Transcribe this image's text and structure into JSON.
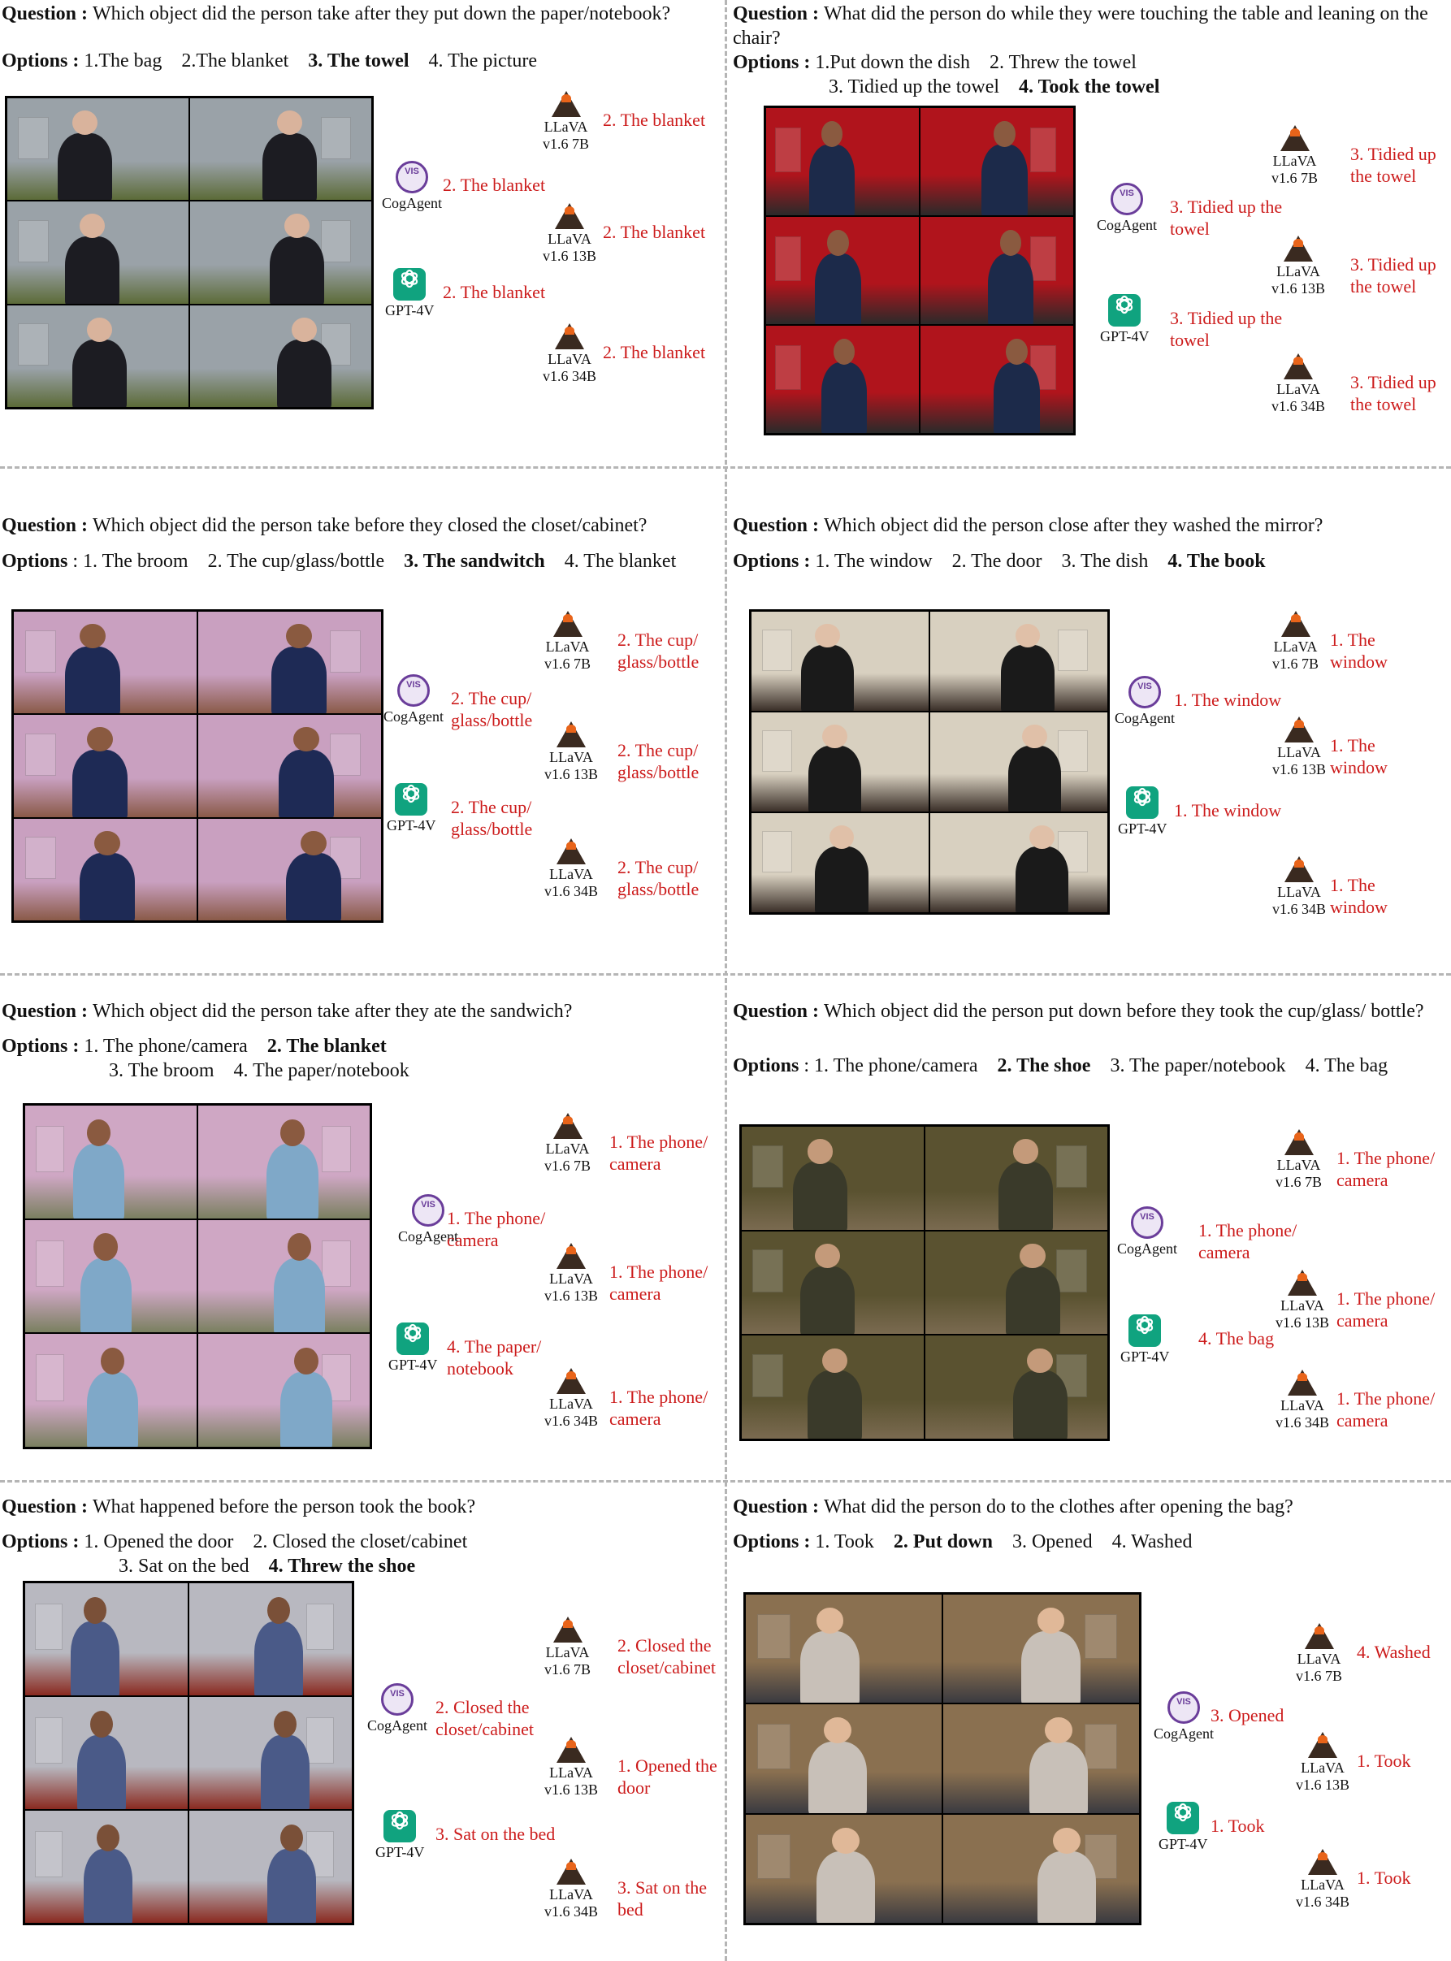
{
  "labels": {
    "question": "Question :",
    "options": "Options :",
    "options_alt": "Options"
  },
  "colors": {
    "answer": "#cc1b1b",
    "separator": "#b5b5b5",
    "gpt": "#10a37f",
    "cogagent": "#6a3d9a"
  },
  "icons": {
    "llava": "volcano-icon",
    "cogagent": "cogagent-logo-icon",
    "gpt4v": "openai-logo-icon"
  },
  "models": {
    "llava7": [
      "LLaVA",
      "v1.6 7B"
    ],
    "llava13": [
      "LLaVA",
      "v1.6 13B"
    ],
    "llava34": [
      "LLaVA",
      "v1.6 34B"
    ],
    "cog": "CogAgent",
    "gpt": "GPT-4V"
  },
  "panels": [
    {
      "question": "Which object did the person take after they put down the paper/notebook?",
      "options_line1": [
        {
          "t": "1.The bag",
          "b": false
        },
        {
          "t": "2.The blanket",
          "b": false
        },
        {
          "t": "3. The towel",
          "b": true
        },
        {
          "t": "4. The picture",
          "b": false
        }
      ],
      "options_line2": [],
      "answers": {
        "cog": "2. The blanket",
        "gpt": "2. The blanket",
        "llava7": "2. The blanket",
        "llava13": "2. The blanket",
        "llava34": "2. The blanket"
      }
    },
    {
      "question": "What did the person do while they were touching the table and leaning on the chair?",
      "options_line1": [
        {
          "t": "1.Put down the dish",
          "b": false
        },
        {
          "t": "2. Threw the towel",
          "b": false
        }
      ],
      "options_line2": [
        {
          "t": "3. Tidied up the towel",
          "b": false
        },
        {
          "t": "4. Took the towel",
          "b": true
        }
      ],
      "answers": {
        "cog": "3. Tidied up the towel",
        "gpt": "3. Tidied up the towel",
        "llava7": "3. Tidied up the towel",
        "llava13": "3. Tidied up the towel",
        "llava34": "3. Tidied up the towel"
      }
    },
    {
      "question": "Which object did the person take before they closed the closet/cabinet?",
      "options_line1": [
        {
          "t": "1. The broom",
          "b": false
        },
        {
          "t": "2. The cup/glass/bottle",
          "b": false
        },
        {
          "t": "3. The sandwitch",
          "b": true
        },
        {
          "t": "4. The blanket",
          "b": false
        }
      ],
      "options_line2": [],
      "answers": {
        "cog": "2. The cup/ glass/bottle",
        "gpt": "2. The cup/ glass/bottle",
        "llava7": "2. The cup/ glass/bottle",
        "llava13": "2. The cup/ glass/bottle",
        "llava34": "2. The cup/ glass/bottle"
      }
    },
    {
      "question": "Which object did the person close after they washed the mirror?",
      "options_line1": [
        {
          "t": "1. The window",
          "b": false
        },
        {
          "t": "2. The door",
          "b": false
        },
        {
          "t": "3. The dish",
          "b": false
        },
        {
          "t": "4. The book",
          "b": true
        }
      ],
      "options_line2": [],
      "answers": {
        "cog": "1. The window",
        "gpt": "1. The window",
        "llava7": "1. The window",
        "llava13": "1. The window",
        "llava34": "1. The window"
      }
    },
    {
      "question": "Which object did the person take after they ate the sandwich?",
      "options_line1": [
        {
          "t": "1. The phone/camera",
          "b": false
        },
        {
          "t": "2. The blanket",
          "b": true
        }
      ],
      "options_line2": [
        {
          "t": "3. The broom",
          "b": false
        },
        {
          "t": "4. The paper/notebook",
          "b": false
        }
      ],
      "answers": {
        "cog": "1. The phone/ camera",
        "gpt": "4. The paper/ notebook",
        "llava7": "1. The phone/ camera",
        "llava13": "1. The phone/ camera",
        "llava34": "1. The phone/ camera"
      }
    },
    {
      "question": "Which object did the person put down before they took the cup/glass/ bottle?",
      "options_line1": [
        {
          "t": "1. The phone/camera",
          "b": false
        },
        {
          "t": "2. The shoe",
          "b": true
        },
        {
          "t": "3. The paper/notebook",
          "b": false
        },
        {
          "t": "4. The bag",
          "b": false
        }
      ],
      "options_line2": [],
      "answers": {
        "cog": "1. The phone/ camera",
        "gpt": "4. The bag",
        "llava7": "1. The phone/ camera",
        "llava13": "1. The phone/ camera",
        "llava34": "1. The phone/ camera"
      }
    },
    {
      "question": "What happened before the person took the book?",
      "options_line1": [
        {
          "t": "1. Opened the door",
          "b": false
        },
        {
          "t": "2. Closed the closet/cabinet",
          "b": false
        }
      ],
      "options_line2": [
        {
          "t": "3. Sat on the bed",
          "b": false
        },
        {
          "t": "4. Threw the shoe",
          "b": true
        }
      ],
      "answers": {
        "cog": "2. Closed the closet/cabinet",
        "gpt": "3. Sat on the bed",
        "llava7": "2. Closed the closet/cabinet",
        "llava13": "1. Opened the door",
        "llava34": "3. Sat on the bed"
      }
    },
    {
      "question": "What did the person do to the clothes after opening the bag?",
      "options_line1": [
        {
          "t": "1. Took",
          "b": false
        },
        {
          "t": "2. Put down",
          "b": true
        },
        {
          "t": "3. Opened",
          "b": false
        },
        {
          "t": "4. Washed",
          "b": false
        }
      ],
      "options_line2": [],
      "answers": {
        "cog": "3. Opened",
        "gpt": "1. Took",
        "llava7": "4. Washed",
        "llava13": "1. Took",
        "llava34": "1. Took"
      }
    }
  ]
}
